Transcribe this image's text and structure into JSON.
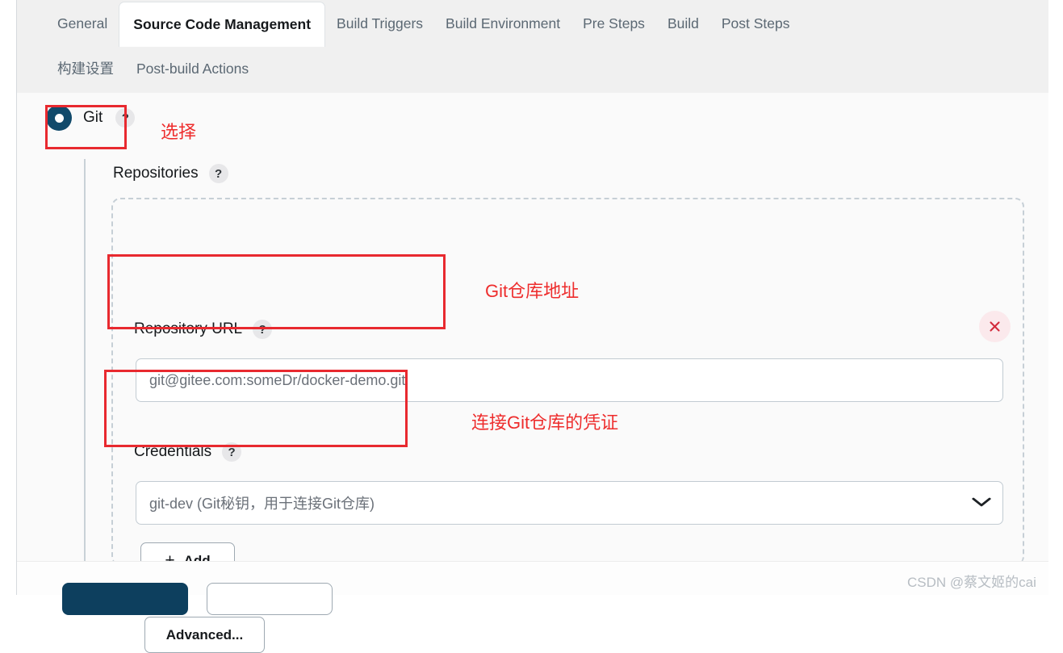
{
  "tabs": {
    "row1": [
      {
        "label": "General",
        "active": false
      },
      {
        "label": "Source Code Management",
        "active": true
      },
      {
        "label": "Build Triggers",
        "active": false
      },
      {
        "label": "Build Environment",
        "active": false
      },
      {
        "label": "Pre Steps",
        "active": false
      },
      {
        "label": "Build",
        "active": false
      },
      {
        "label": "Post Steps",
        "active": false
      }
    ],
    "row2": [
      {
        "label": "构建设置",
        "active": false
      },
      {
        "label": "Post-build Actions",
        "active": false
      }
    ]
  },
  "scm": {
    "selected_label": "Git",
    "help_glyph": "?",
    "repositories_label": "Repositories",
    "repository_url_label": "Repository URL",
    "repository_url_value": "git@gitee.com:someDr/docker-demo.git",
    "credentials_label": "Credentials",
    "credentials_value": "git-dev (Git秘钥，用于连接Git仓库)",
    "chevron_glyph": "⌄",
    "add_button_label": "Add",
    "add_button_plus": "+",
    "advanced_button_label": "Advanced...",
    "delete_icon_name": "close-icon"
  },
  "footer": {
    "save_label": "",
    "apply_label": ""
  },
  "annotations": {
    "select_note": "选择",
    "repo_url_note": "Git仓库地址",
    "credentials_note": "连接Git仓库的凭证"
  },
  "watermark": {
    "text": "CSDN @蔡文姬的cai"
  },
  "colors": {
    "radio_navy": "#114a6b",
    "annotation_red": "#ee2d2d",
    "save_button_navy": "#0d3f5e",
    "delete_pink": "#fbe9ec",
    "delete_red": "#d32b3c"
  }
}
